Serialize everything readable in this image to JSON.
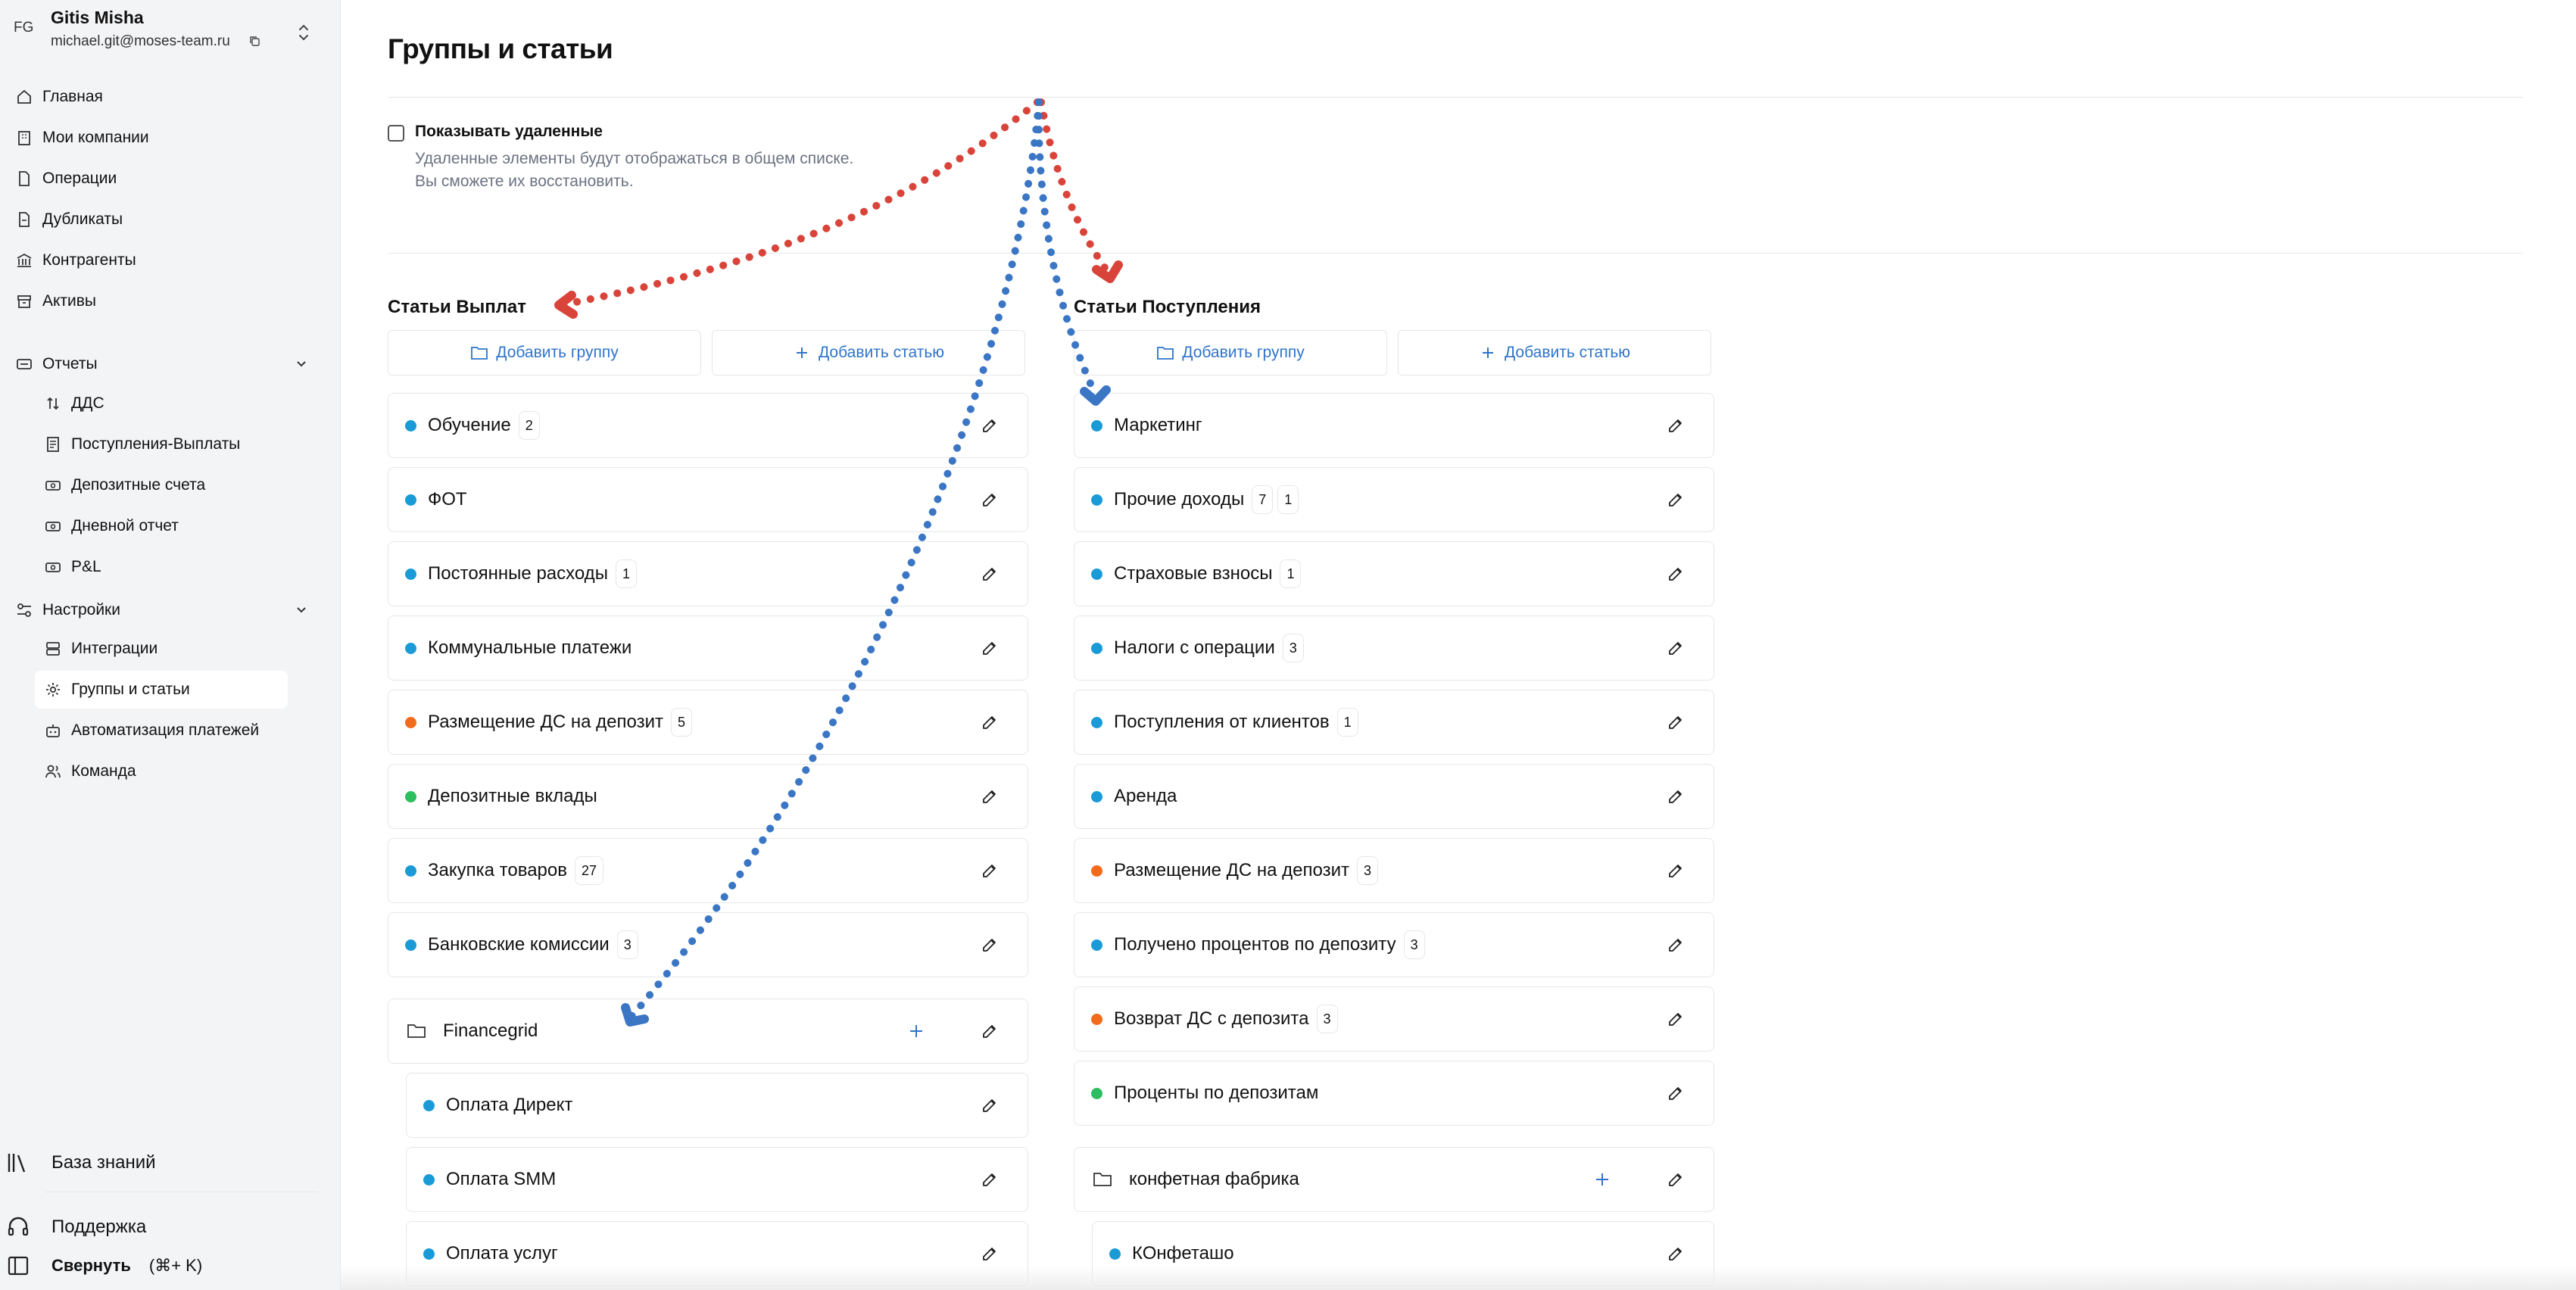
{
  "user": {
    "initials": "FG",
    "name": "Gitis Misha",
    "email": "michael.git@moses-team.ru"
  },
  "nav": {
    "home": "Главная",
    "companies": "Мои компании",
    "operations": "Операции",
    "duplicates": "Дубликаты",
    "counterparties": "Контрагенты",
    "assets": "Активы",
    "reports": "Отчеты",
    "reports_items": [
      "ДДС",
      "Поступления-Выплаты",
      "Депозитные счета",
      "Дневной отчет",
      "P&L"
    ],
    "settings": "Настройки",
    "settings_items": [
      "Интеграции",
      "Группы и статьи",
      "Автоматизация платежей",
      "Команда"
    ],
    "knowledge_base": "База знаний",
    "support": "Поддержка",
    "collapse": "Свернуть",
    "collapse_shortcut": "(⌘+ K)"
  },
  "page": {
    "title": "Группы и статьи",
    "show_deleted_label": "Показывать удаленные",
    "show_deleted_checked": false,
    "show_deleted_desc_1": "Удаленные элементы будут отображаться в общем списке.",
    "show_deleted_desc_2": "Вы сможете их восстановить."
  },
  "payouts": {
    "title": "Статьи Выплат",
    "add_group": "Добавить группу",
    "add_article": "Добавить статью",
    "items": [
      {
        "label": "Обучение",
        "color": "#1a9bd7",
        "badges": [
          "2"
        ]
      },
      {
        "label": "ФОТ",
        "color": "#1a9bd7",
        "badges": []
      },
      {
        "label": "Постоянные расходы",
        "color": "#1a9bd7",
        "badges": [
          "1"
        ]
      },
      {
        "label": "Коммунальные платежи",
        "color": "#1a9bd7",
        "badges": []
      },
      {
        "label": "Размещение ДС на депозит",
        "color": "#f26b1d",
        "badges": [
          "5"
        ]
      },
      {
        "label": "Депозитные вклады",
        "color": "#2dbe60",
        "badges": []
      },
      {
        "label": "Закупка товаров",
        "color": "#1a9bd7",
        "badges": [
          "27"
        ]
      },
      {
        "label": "Банковские комиссии",
        "color": "#1a9bd7",
        "badges": [
          "3"
        ]
      }
    ],
    "group": {
      "label": "Financegrid",
      "children": [
        {
          "label": "Оплата Директ",
          "color": "#1a9bd7"
        },
        {
          "label": "Оплата SMM",
          "color": "#1a9bd7"
        },
        {
          "label": "Оплата услуг",
          "color": "#1a9bd7"
        }
      ]
    }
  },
  "incomes": {
    "title": "Статьи Поступления",
    "add_group": "Добавить группу",
    "add_article": "Добавить статью",
    "items": [
      {
        "label": "Маркетинг",
        "color": "#1a9bd7",
        "badges": []
      },
      {
        "label": "Прочие доходы",
        "color": "#1a9bd7",
        "badges": [
          "7",
          "1"
        ]
      },
      {
        "label": "Страховые взносы",
        "color": "#1a9bd7",
        "badges": [
          "1"
        ]
      },
      {
        "label": "Налоги с операции",
        "color": "#1a9bd7",
        "badges": [
          "3"
        ]
      },
      {
        "label": "Поступления от клиентов",
        "color": "#1a9bd7",
        "badges": [
          "1"
        ]
      },
      {
        "label": "Аренда",
        "color": "#1a9bd7",
        "badges": []
      },
      {
        "label": "Размещение ДС на депозит",
        "color": "#f26b1d",
        "badges": [
          "3"
        ]
      },
      {
        "label": "Получено процентов по депозиту",
        "color": "#1a9bd7",
        "badges": [
          "3"
        ]
      },
      {
        "label": "Возврат ДС с депозита",
        "color": "#f26b1d",
        "badges": [
          "3"
        ]
      },
      {
        "label": "Проценты по депозитам",
        "color": "#2dbe60",
        "badges": []
      }
    ],
    "group": {
      "label": "конфетная фабрика",
      "children": [
        {
          "label": "КОнфеташо",
          "color": "#1a9bd7"
        }
      ]
    }
  },
  "colors": {
    "accent": "#2f74c9",
    "annotation_red": "#d9443a",
    "annotation_blue": "#3b76c4"
  }
}
